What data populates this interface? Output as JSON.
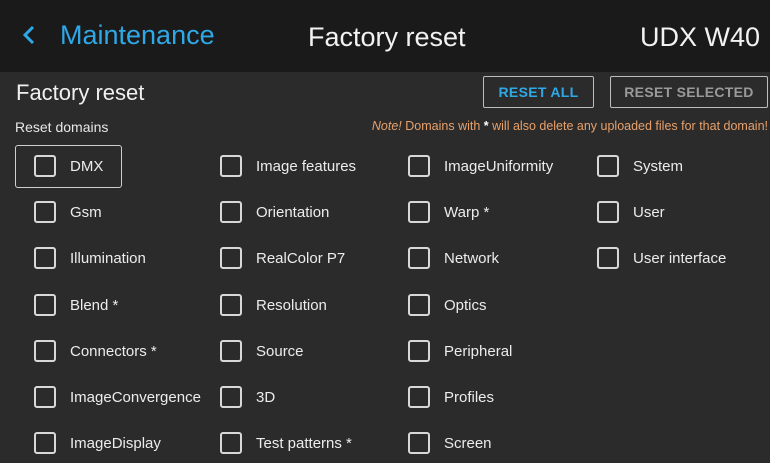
{
  "header": {
    "back_label": "Maintenance",
    "title": "Factory reset",
    "device": "UDX W40"
  },
  "page": {
    "title": "Factory reset",
    "subtitle": "Reset domains",
    "reset_all": "RESET ALL",
    "reset_selected": "RESET SELECTED",
    "note_prefix": "Note!",
    "note_mid1": " Domains with ",
    "note_star": "*",
    "note_mid2": " will also delete any uploaded files for that domain!"
  },
  "colors": {
    "accent": "#2ea8e6",
    "note": "#e8a06a",
    "header_bg": "#1a1a1a",
    "bg": "#2b2b2b"
  },
  "domains": {
    "col1": [
      "DMX",
      "Gsm",
      "Illumination",
      "Blend *",
      "Connectors *",
      "ImageConvergence",
      "ImageDisplay"
    ],
    "col2": [
      "Image features",
      "Orientation",
      "RealColor P7",
      "Resolution",
      "Source",
      "3D",
      "Test patterns *"
    ],
    "col3": [
      "ImageUniformity",
      "Warp *",
      "Network",
      "Optics",
      "Peripheral",
      "Profiles",
      "Screen"
    ],
    "col4": [
      "System",
      "User",
      "User interface"
    ]
  }
}
